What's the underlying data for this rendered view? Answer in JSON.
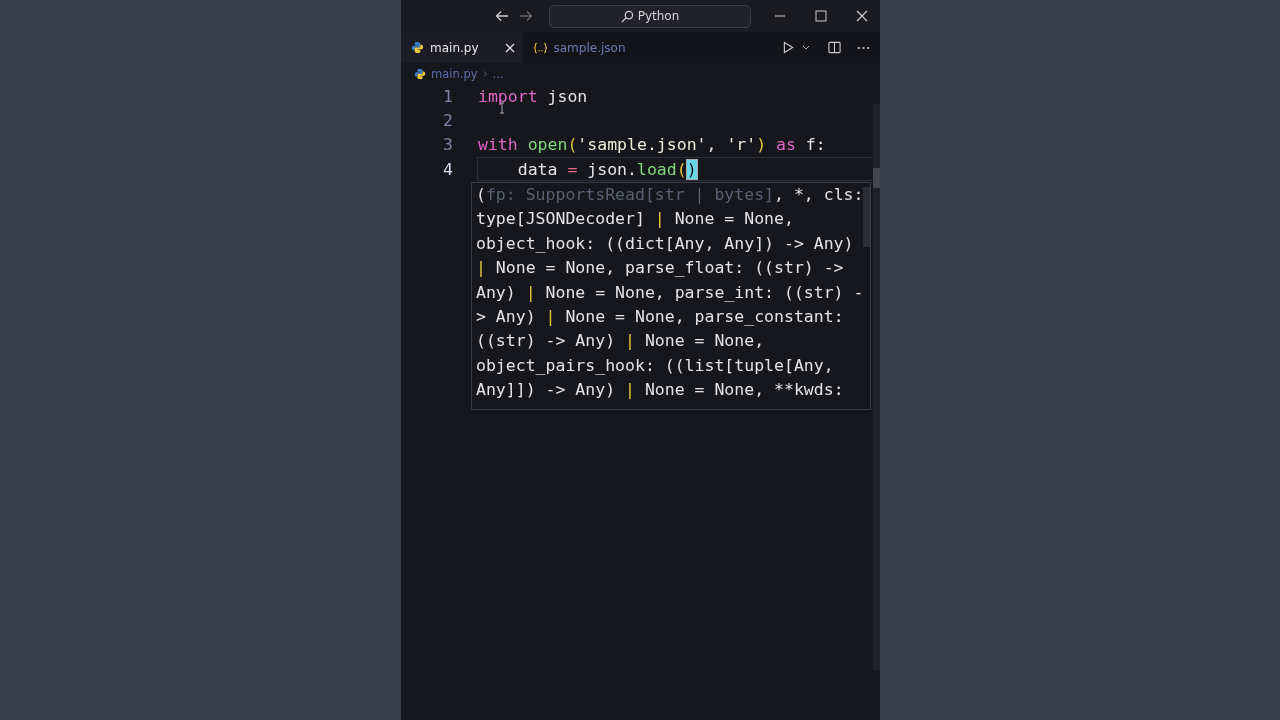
{
  "title_bar": {
    "search": "Python"
  },
  "tabs": [
    {
      "label": "main.py",
      "kind": "python",
      "selected": true
    },
    {
      "label": "sample.json",
      "kind": "json",
      "selected": false
    }
  ],
  "breadcrumb": [
    "main.py",
    "..."
  ],
  "editor": {
    "lines": [
      {
        "number": "1",
        "active": false,
        "tokens": [
          {
            "kind": "keyword",
            "text": "import"
          },
          {
            "kind": "plain",
            "text": " json"
          }
        ]
      },
      {
        "number": "2",
        "active": false
      },
      {
        "number": "3",
        "active": false,
        "tokens": [
          {
            "kind": "keyword",
            "text": "with "
          },
          {
            "kind": "func",
            "text": "open"
          },
          {
            "kind": "paren",
            "text": "("
          },
          {
            "kind": "string",
            "text": "'sample.json'"
          },
          {
            "kind": "plain",
            "text": ", "
          },
          {
            "kind": "string",
            "text": "'r'"
          },
          {
            "kind": "paren",
            "text": ")"
          },
          {
            "kind": "keyword",
            "text": " as"
          },
          {
            "kind": "plain",
            "text": " f:"
          }
        ]
      },
      {
        "number": "4",
        "active": true,
        "tokens": [
          {
            "kind": "plain",
            "text": "    data "
          },
          {
            "kind": "operator",
            "text": "="
          },
          {
            "kind": "plain",
            "text": " json."
          },
          {
            "kind": "func",
            "text": "load"
          },
          {
            "kind": "paren",
            "text": "("
          },
          {
            "kind": "matched",
            "text": ")"
          }
        ]
      }
    ]
  },
  "signature_popup": {
    "lines": [
      [
        {
          "kind": "plain",
          "text": "("
        },
        {
          "kind": "dim",
          "text": "fp: SupportsRead[str | bytes]"
        },
        {
          "kind": "plain",
          "text": ", *, cls:"
        }
      ],
      [
        {
          "kind": "plain",
          "text": "type[JSONDecoder] "
        },
        {
          "kind": "pipe",
          "text": "|"
        },
        {
          "kind": "plain",
          "text": " None = None,"
        }
      ],
      [
        {
          "kind": "plain",
          "text": "object_hook: ((dict[Any, Any]) -> Any)"
        }
      ],
      [
        {
          "kind": "pipe",
          "text": "|"
        },
        {
          "kind": "plain",
          "text": " None = None, parse_float: ((str) ->"
        }
      ],
      [
        {
          "kind": "plain",
          "text": "Any) "
        },
        {
          "kind": "pipe",
          "text": "|"
        },
        {
          "kind": "plain",
          "text": " None = None, parse_int: ((str) -"
        }
      ],
      [
        {
          "kind": "plain",
          "text": "> Any) "
        },
        {
          "kind": "pipe",
          "text": "|"
        },
        {
          "kind": "plain",
          "text": " None = None, parse_constant:"
        }
      ],
      [
        {
          "kind": "plain",
          "text": "((str) -> Any) "
        },
        {
          "kind": "pipe",
          "text": "|"
        },
        {
          "kind": "plain",
          "text": " None = None,"
        }
      ],
      [
        {
          "kind": "plain",
          "text": "object_pairs_hook: ((list[tuple[Any,"
        }
      ],
      [
        {
          "kind": "plain",
          "text": "Any]]) -> Any) "
        },
        {
          "kind": "pipe",
          "text": "|"
        },
        {
          "kind": "plain",
          "text": " None = None, **kwds:"
        }
      ]
    ]
  }
}
